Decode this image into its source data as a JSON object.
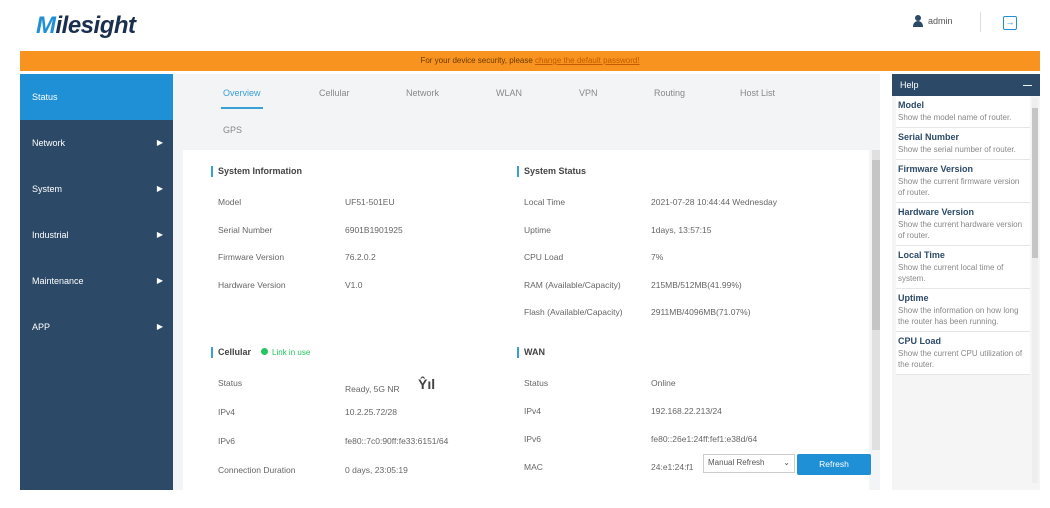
{
  "header": {
    "logo": "Milesight",
    "user": "admin",
    "logout_icon": "logout-icon"
  },
  "banner": {
    "text": "For your device security, please ",
    "link": "change the default password!"
  },
  "sidebar": {
    "items": [
      {
        "label": "Status",
        "active": true
      },
      {
        "label": "Network"
      },
      {
        "label": "System"
      },
      {
        "label": "Industrial"
      },
      {
        "label": "Maintenance"
      },
      {
        "label": "APP"
      }
    ]
  },
  "tabs": [
    "Overview",
    "Cellular",
    "Network",
    "WLAN",
    "VPN",
    "Routing",
    "Host List",
    "GPS"
  ],
  "system_information": {
    "title": "System Information",
    "rows": [
      [
        "Model",
        "UF51-501EU"
      ],
      [
        "Serial Number",
        "6901B1901925"
      ],
      [
        "Firmware Version",
        "76.2.0.2"
      ],
      [
        "Hardware Version",
        "V1.0"
      ]
    ]
  },
  "system_status": {
    "title": "System Status",
    "rows": [
      [
        "Local Time",
        "2021-07-28 10:44:44 Wednesday"
      ],
      [
        "Uptime",
        "1days, 13:57:15"
      ],
      [
        "CPU Load",
        "7%"
      ],
      [
        "RAM (Available/Capacity)",
        "215MB/512MB(41.99%)"
      ],
      [
        "Flash (Available/Capacity)",
        "2911MB/4096MB(71.07%)"
      ]
    ]
  },
  "cellular": {
    "title": "Cellular",
    "link_status": "Link in use",
    "rows": [
      [
        "Status",
        "Ready, 5G NR"
      ],
      [
        "IPv4",
        "10.2.25.72/28"
      ],
      [
        "IPv6",
        "fe80::7c0:90ff:fe33:6151/64"
      ],
      [
        "Connection Duration",
        "0 days, 23:05:19"
      ]
    ]
  },
  "wan": {
    "title": "WAN",
    "rows": [
      [
        "Status",
        "Online"
      ],
      [
        "IPv4",
        "192.168.22.213/24"
      ],
      [
        "IPv6",
        "fe80::26e1:24ff:fef1:e38d/64"
      ],
      [
        "MAC",
        "24:e1:24:f1"
      ]
    ]
  },
  "refresh": {
    "mode": "Manual Refresh",
    "button": "Refresh"
  },
  "help": {
    "title": "Help",
    "items": [
      {
        "title": "Model",
        "desc": "Show the model name of router."
      },
      {
        "title": "Serial Number",
        "desc": "Show the serial number of router."
      },
      {
        "title": "Firmware Version",
        "desc": "Show the current firmware version of router."
      },
      {
        "title": "Hardware Version",
        "desc": "Show the current hardware version of router."
      },
      {
        "title": "Local Time",
        "desc": "Show the current local time of system."
      },
      {
        "title": "Uptime",
        "desc": "Show the information on how long the router has been running."
      },
      {
        "title": "CPU Load",
        "desc": "Show the current CPU utilization of the router."
      }
    ]
  }
}
